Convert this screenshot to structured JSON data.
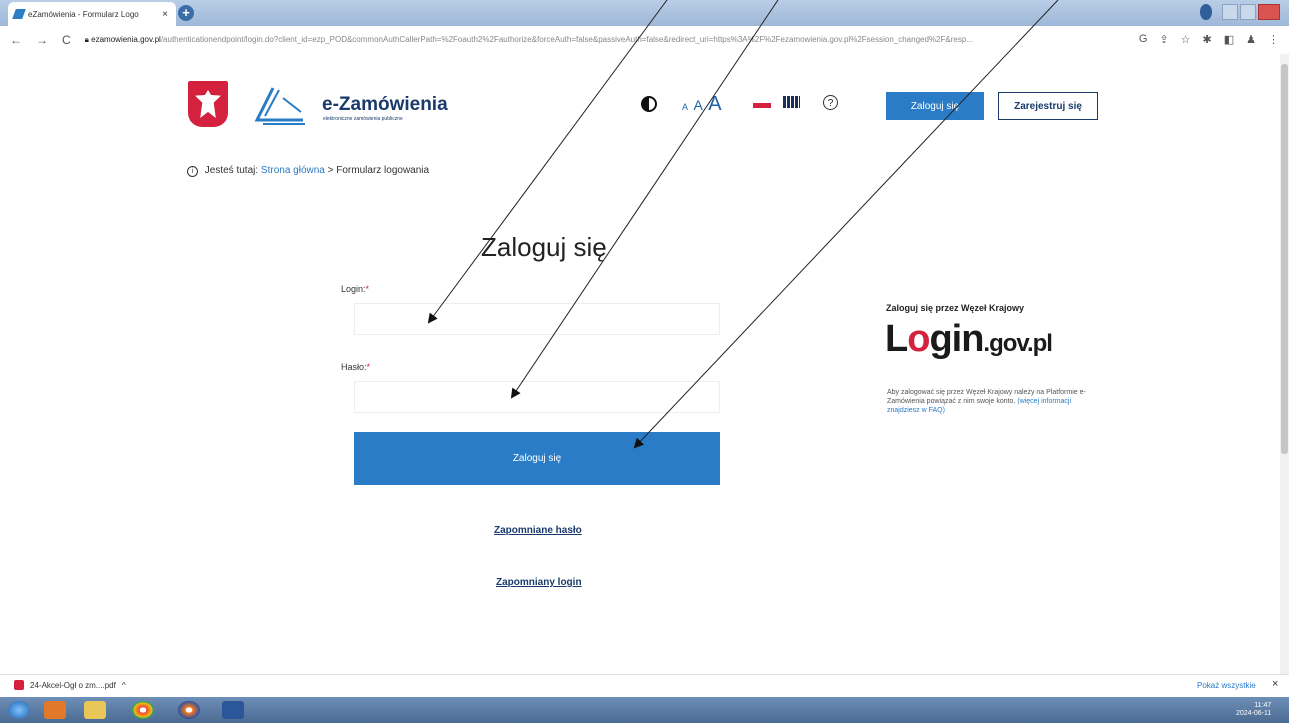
{
  "browser": {
    "tab_title": "eZamówienia - Formularz Logo",
    "tab_close": "×",
    "new_tab": "+",
    "url_host": "ezamowienia.gov.pl",
    "url_path": "/authenticationendpoint/login.do?client_id=ezp_POD&commonAuthCallerPath=%2Foauth2%2Fauthorize&forceAuth=false&passiveAuth=false&redirect_uri=https%3A%2F%2Fezamowienia.gov.pl%2Fsession_changed%2F&resp..."
  },
  "header": {
    "brand": "e-Zamówienia",
    "brand_sub": "elektroniczne zamówienia publiczne",
    "font_small": "A",
    "font_medium": "A",
    "font_large": "A",
    "help": "?",
    "login_button": "Zaloguj się",
    "register_button": "Zarejestruj się"
  },
  "breadcrumb": {
    "info": "i",
    "prefix": "Jesteś tutaj:",
    "home": "Strona główna",
    "separator": ">",
    "current": "Formularz logowania"
  },
  "form": {
    "title": "Zaloguj się",
    "login_label": "Login:",
    "password_label": "Hasło:",
    "required_mark": "*",
    "submit": "Zaloguj się",
    "forgot_password": "Zapomniane hasło",
    "forgot_login": "Zapomniany login"
  },
  "wezel": {
    "title": "Zaloguj się przez Węzeł Krajowy",
    "logo_l": "L",
    "logo_o": "o",
    "logo_gin": "gin",
    "logo_gov": ".gov.pl",
    "desc": "Aby zalogować się przez Węzeł Krajowy należy na Platformie e-Zamówienia powiązać z nim swoje konto.",
    "desc_link": "(więcej informacji znajdziesz w FAQ)"
  },
  "downloads": {
    "file": "24-Akcel-Ogł o zm....pdf",
    "chevron": "^",
    "show_all": "Pokaż wszystkie",
    "close": "×"
  },
  "taskbar": {
    "time": "11:47",
    "date": "2024-06-11"
  }
}
